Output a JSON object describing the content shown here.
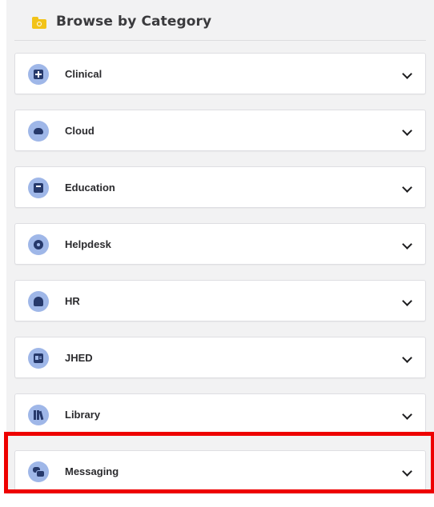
{
  "header": {
    "title": "Browse by Category",
    "icon": "folder-search-icon"
  },
  "categories": [
    {
      "label": "Clinical",
      "icon": "medical-cross-icon"
    },
    {
      "label": "Cloud",
      "icon": "cloud-icon"
    },
    {
      "label": "Education",
      "icon": "book-icon"
    },
    {
      "label": "Helpdesk",
      "icon": "gear-icon"
    },
    {
      "label": "HR",
      "icon": "users-icon"
    },
    {
      "label": "JHED",
      "icon": "id-card-icon"
    },
    {
      "label": "Library",
      "icon": "library-icon"
    },
    {
      "label": "Messaging",
      "icon": "chat-icon"
    }
  ],
  "colors": {
    "icon_circle": "#9fb7e8",
    "icon_glyph": "#26396b",
    "folder": "#f2c318",
    "highlight": "#ee0000"
  },
  "highlighted_item": "Messaging"
}
